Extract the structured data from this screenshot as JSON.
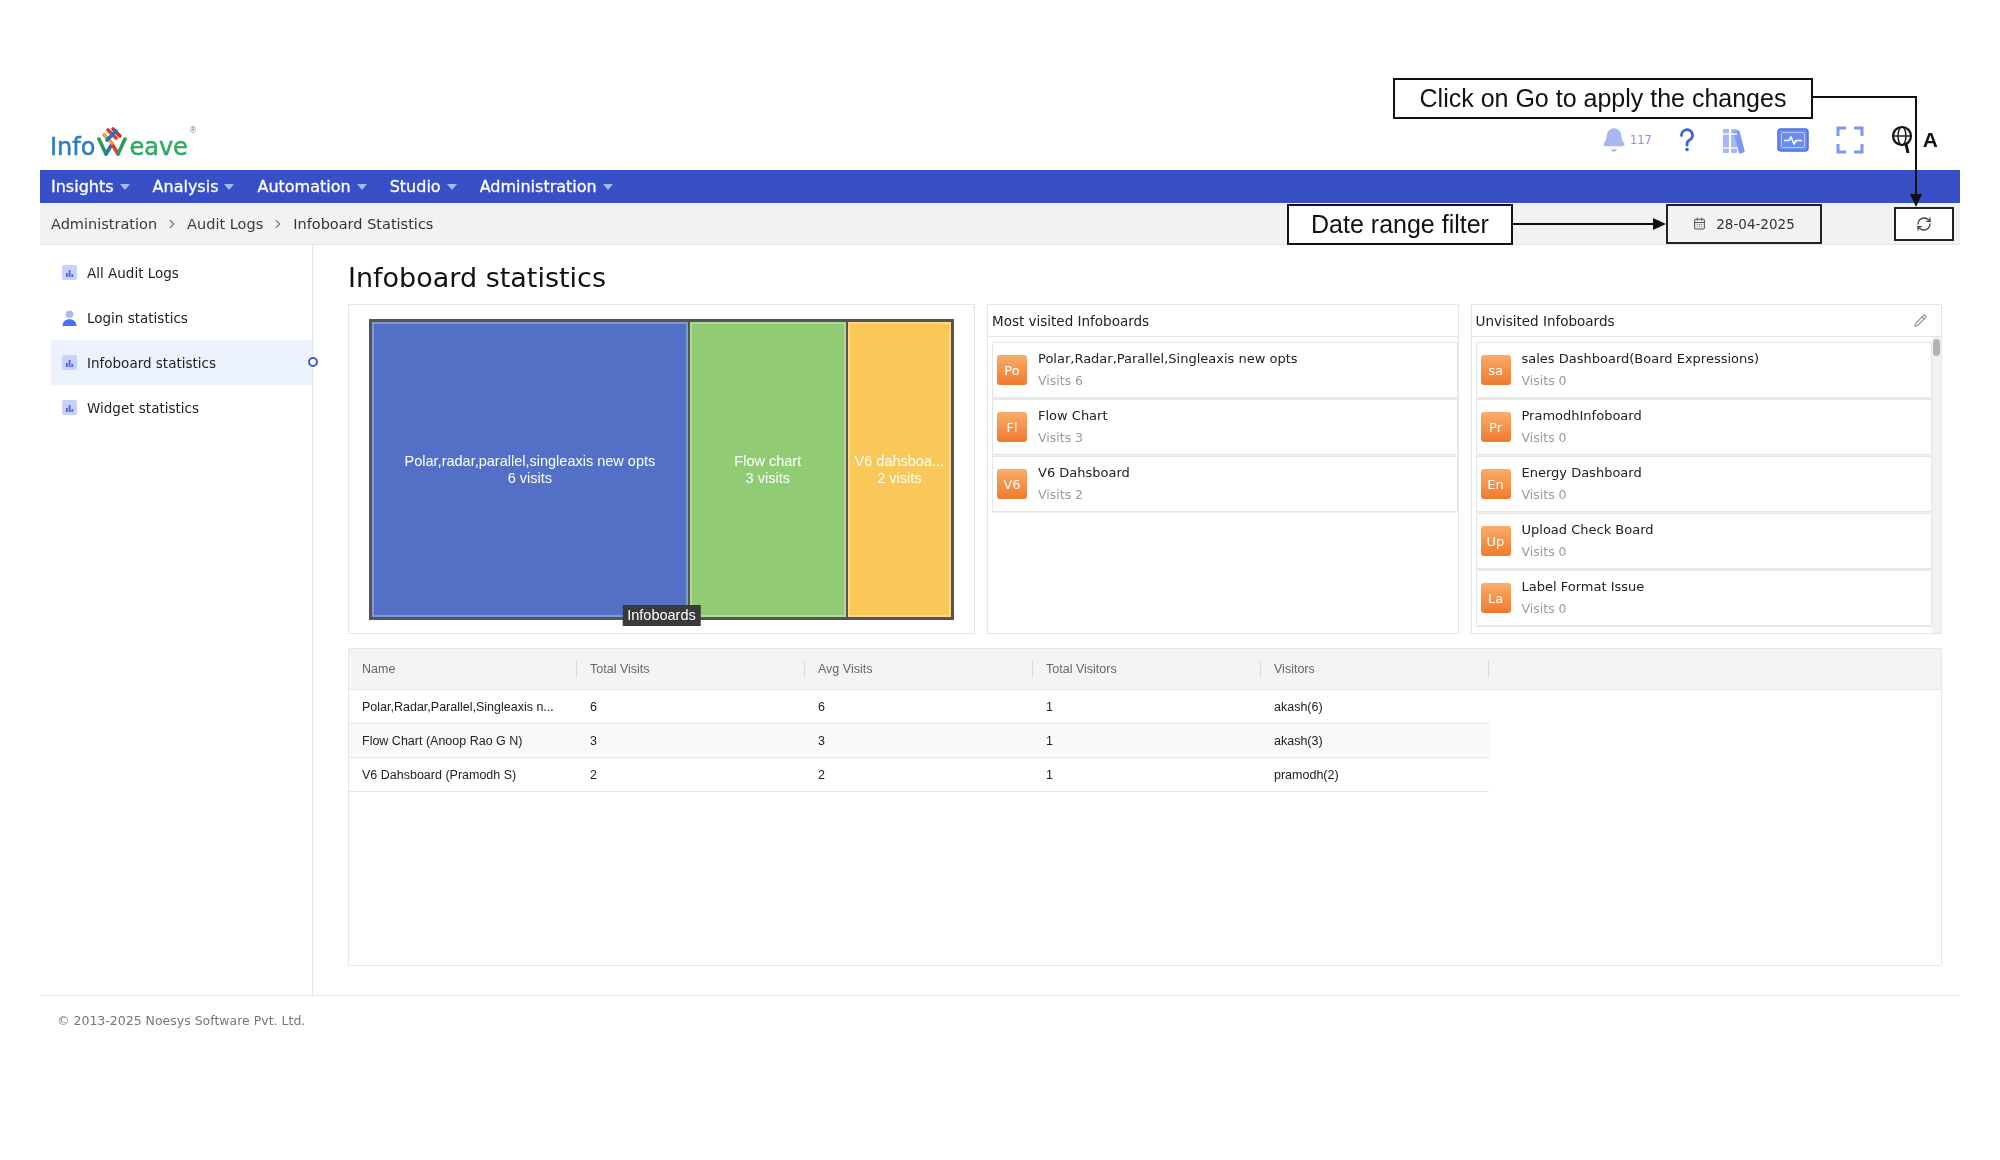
{
  "logo": {
    "prefix": "Info",
    "suffix": "eave",
    "mark": "®"
  },
  "header": {
    "notification_count": "117",
    "user_label": "A"
  },
  "callouts": [
    {
      "text": "Click on Go to apply the changes"
    },
    {
      "text": "Date range filter"
    }
  ],
  "nav": {
    "items": [
      {
        "label": "Insights",
        "selected": false
      },
      {
        "label": "Analysis",
        "selected": false
      },
      {
        "label": "Automation",
        "selected": false
      },
      {
        "label": "Studio",
        "selected": false
      },
      {
        "label": "Administration",
        "selected": false
      }
    ]
  },
  "breadcrumbs": [
    "Administration",
    "Audit Logs",
    "Infoboard Statistics"
  ],
  "date_filter": {
    "value": "28-04-2025"
  },
  "sidebar": {
    "items": [
      {
        "label": "All Audit Logs",
        "kind": "chart",
        "selected": false
      },
      {
        "label": "Login statistics",
        "kind": "user",
        "selected": false
      },
      {
        "label": "Infoboard statistics",
        "kind": "chart",
        "selected": true
      },
      {
        "label": "Widget statistics",
        "kind": "chart",
        "selected": false
      }
    ]
  },
  "page_title": "Infoboard statistics",
  "treemap": {
    "label": "Infoboards",
    "tiles": [
      {
        "name": "Polar,radar,parallel,singleaxis new opts",
        "visits": "6 visits",
        "color": "#5470c6"
      },
      {
        "name": "Flow chart",
        "visits": "3 visits",
        "color": "#91cc75"
      },
      {
        "name": "V6 dahsboa...",
        "visits": "2 visits",
        "color": "#fac858"
      }
    ]
  },
  "most_visited": {
    "title": "Most visited Infoboards",
    "items": [
      {
        "initials": "Po",
        "name": "Polar,Radar,Parallel,Singleaxis new opts",
        "visits": "Visits 6"
      },
      {
        "initials": "Fl",
        "name": "Flow Chart",
        "visits": "Visits 3"
      },
      {
        "initials": "V6",
        "name": "V6 Dahsboard",
        "visits": "Visits 2"
      }
    ]
  },
  "unvisited": {
    "title": "Unvisited Infoboards",
    "items": [
      {
        "initials": "sa",
        "name": "sales Dashboard(Board Expressions)",
        "visits": "Visits 0"
      },
      {
        "initials": "Pr",
        "name": "PramodhInfoboard",
        "visits": "Visits 0"
      },
      {
        "initials": "En",
        "name": "Energy Dashboard",
        "visits": "Visits 0"
      },
      {
        "initials": "Up",
        "name": "Upload Check Board",
        "visits": "Visits 0"
      },
      {
        "initials": "La",
        "name": "Label Format Issue",
        "visits": "Visits 0"
      }
    ]
  },
  "table": {
    "columns": [
      "Name",
      "Total Visits",
      "Avg Visits",
      "Total Visitors",
      "Visitors"
    ],
    "rows": [
      [
        "Polar,Radar,Parallel,Singleaxis n...",
        "6",
        "6",
        "1",
        "akash(6)"
      ],
      [
        "Flow Chart (Anoop Rao G N)",
        "3",
        "3",
        "1",
        "akash(3)"
      ],
      [
        "V6 Dahsboard (Pramodh S)",
        "2",
        "2",
        "1",
        "pramodh(2)"
      ]
    ]
  },
  "footer": {
    "text": "© 2013-2025 Noesys Software Pvt. Ltd."
  }
}
